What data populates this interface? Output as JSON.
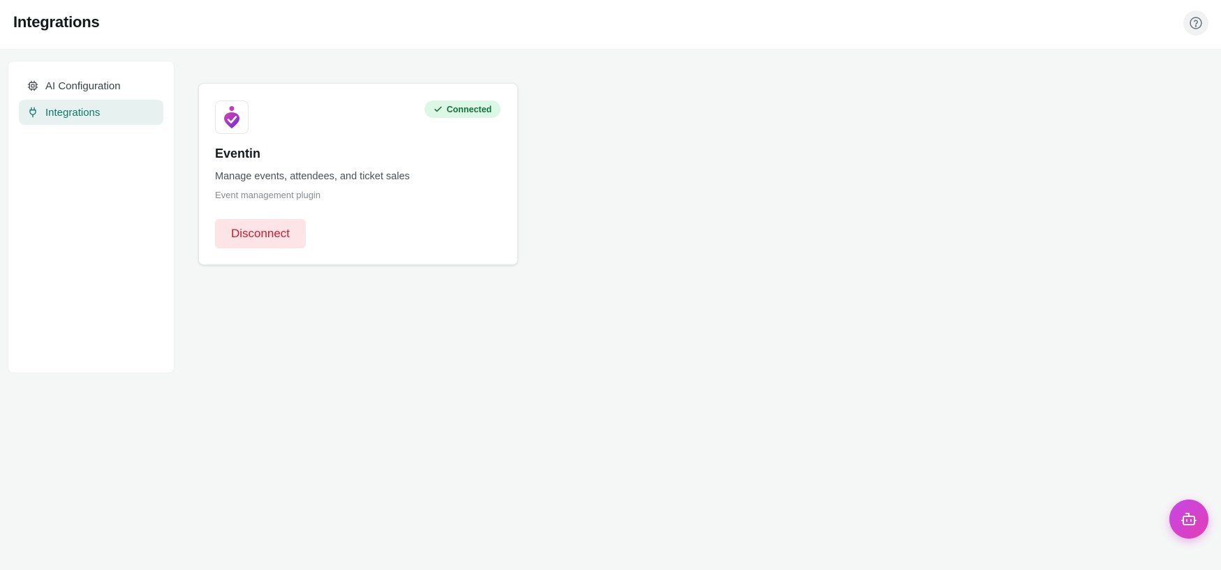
{
  "header": {
    "title": "Integrations",
    "help_icon": "help-circle-icon"
  },
  "sidebar": {
    "items": [
      {
        "label": "AI Configuration",
        "icon": "cpu-chip-icon",
        "active": false
      },
      {
        "label": "Integrations",
        "icon": "plug-icon",
        "active": true
      }
    ]
  },
  "integrations": [
    {
      "name": "Eventin",
      "description": "Manage events, attendees, and ticket sales",
      "subtitle": "Event management plugin",
      "status": "Connected",
      "status_icon": "check-icon",
      "action_label": "Disconnect",
      "logo_icon": "eventin-logo"
    }
  ],
  "fab": {
    "icon": "bot-icon"
  },
  "colors": {
    "accent": "#0c7a66",
    "active_nav_bg": "#e7f2f0",
    "connected_bg": "#dcf7e6",
    "connected_text": "#157340",
    "danger_bg": "#fde4e6",
    "danger_text": "#cf1b2b",
    "fab_gradient_start": "#c548e4",
    "fab_gradient_end": "#e23db6"
  }
}
